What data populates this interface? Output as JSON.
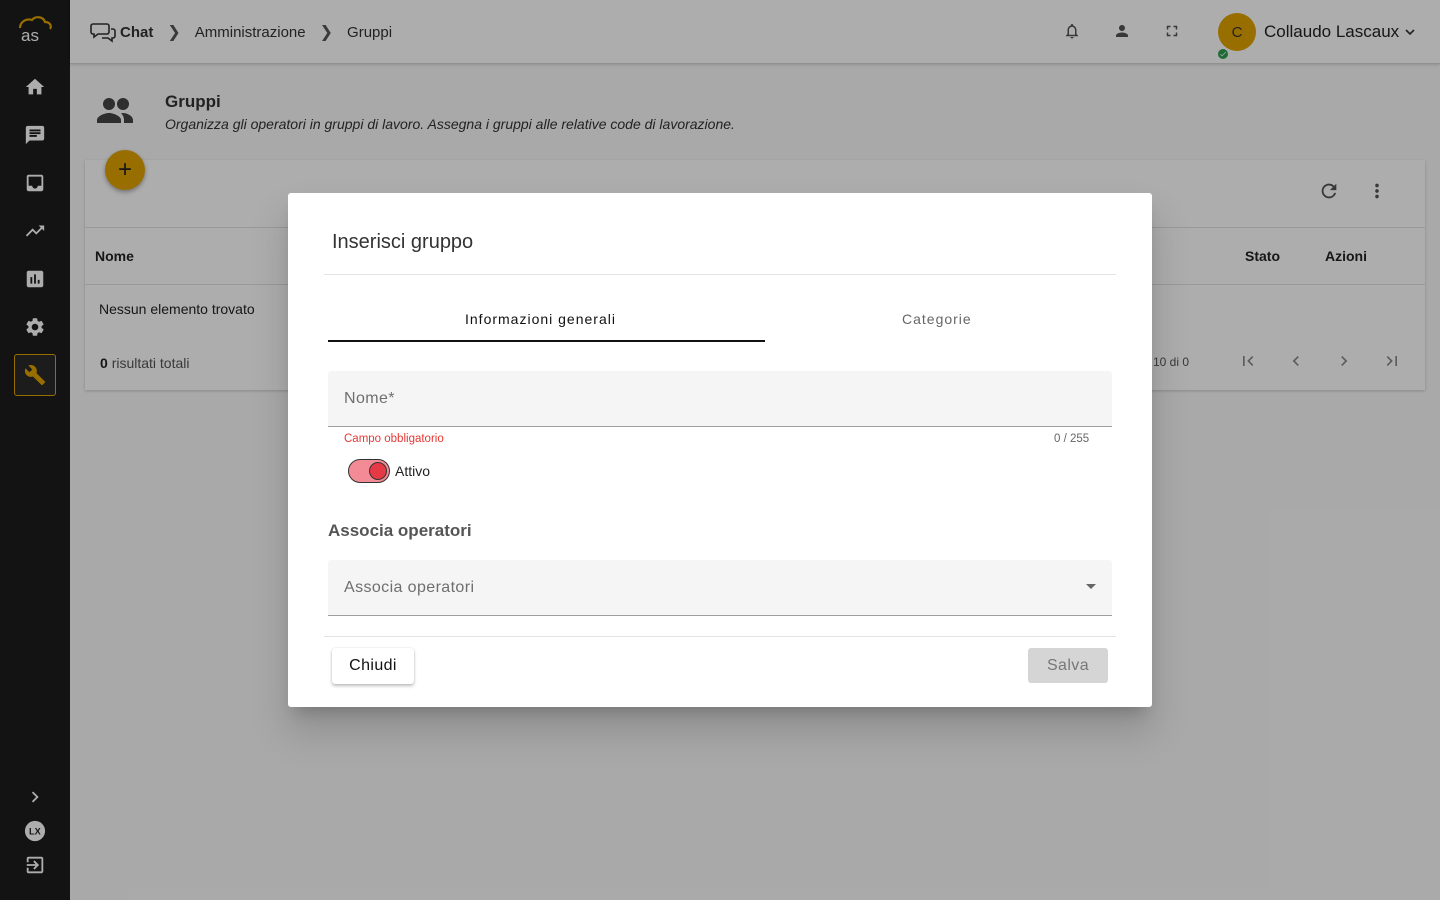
{
  "topbar": {
    "breadcrumb": [
      "Chat",
      "Amministrazione",
      "Gruppi"
    ],
    "user_initial": "C",
    "user_name": "Collaudo Lascaux"
  },
  "logo_text": "as",
  "page": {
    "title": "Gruppi",
    "subtitle": "Organizza gli operatori in gruppi di lavoro. Assegna i gruppi alle relative code di lavorazione."
  },
  "table": {
    "columns": [
      "Nome",
      "Stato",
      "Azioni"
    ],
    "empty_text": "Nessun elemento trovato",
    "total_count": "0",
    "total_label": "risultati totali",
    "range_text": "10 di 0"
  },
  "modal": {
    "title": "Inserisci gruppo",
    "tabs": [
      {
        "label": "Informazioni generali",
        "active": true
      },
      {
        "label": "Categorie",
        "active": false
      }
    ],
    "name_field": {
      "label": "Nome*",
      "error": "Campo obbligatorio",
      "counter": "0 / 255"
    },
    "toggle": {
      "label": "Attivo",
      "on": true
    },
    "operators_section": "Associa operatori",
    "operators_select": {
      "label": "Associa operatori"
    },
    "close_button": "Chiudi",
    "save_button": "Salva"
  },
  "colors": {
    "accent": "#e0a300",
    "sidebar": "#1c1c1c",
    "error": "#e53935",
    "online": "#2e9e4f"
  }
}
